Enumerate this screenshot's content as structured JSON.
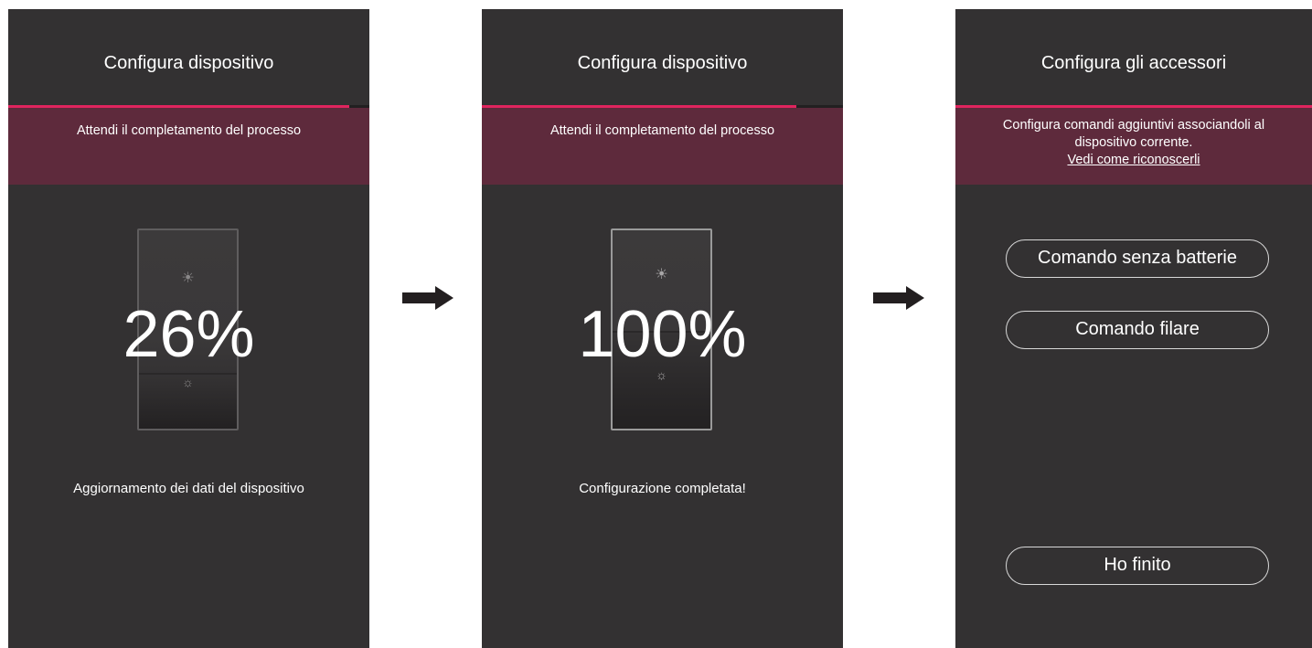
{
  "screen1": {
    "title": "Configura dispositivo",
    "progress": 0.945,
    "banner_text": "Attendi il completamento del processo",
    "percent": "26%",
    "status": "Aggiornamento dei dati del dispositivo"
  },
  "screen2": {
    "title": "Configura dispositivo",
    "progress": 0.87,
    "banner_text": "Attendi il completamento del processo",
    "percent": "100%",
    "status": "Configurazione completata!"
  },
  "screen3": {
    "title": "Configura gli accessori",
    "banner_line1": "Configura comandi aggiuntivi associandoli al",
    "banner_line2": "dispositivo corrente.",
    "banner_link": "Vedi come riconoscerli",
    "buttons": [
      "Comando senza batterie",
      "Comando filare"
    ],
    "finish_button": "Ho finito"
  },
  "colors": {
    "screen_bg": "#333132",
    "accent": "#e0245e",
    "banner_bg": "#5e2a3c"
  },
  "icons": [
    "sun-icon",
    "arrow-right-icon"
  ]
}
